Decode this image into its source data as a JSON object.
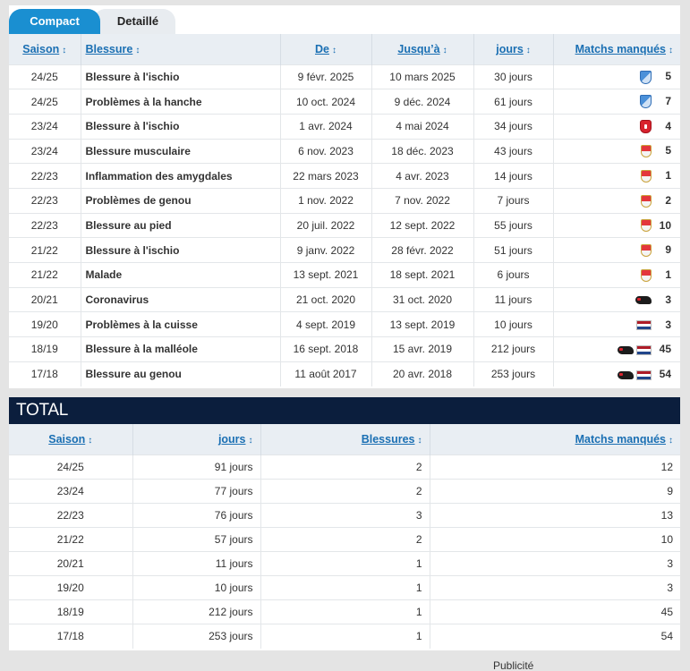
{
  "tabs": {
    "compact": "Compact",
    "detail": "Detaillé"
  },
  "injuries": {
    "headers": [
      "Saison",
      "Blessure",
      "De",
      "Jusqu’à",
      "jours",
      "Matchs manqués"
    ],
    "sort_glyph": "↕",
    "rows": [
      {
        "season": "24/25",
        "injury": "Blessure à l'ischio",
        "from": "9 févr. 2025",
        "until": "10 mars 2025",
        "days": "30 jours",
        "clubs": [
          "stuttgart-shield"
        ],
        "missed": "5"
      },
      {
        "season": "24/25",
        "injury": "Problèmes à la hanche",
        "from": "10 oct. 2024",
        "until": "9 déc. 2024",
        "days": "61 jours",
        "clubs": [
          "stuttgart-shield"
        ],
        "missed": "7"
      },
      {
        "season": "23/24",
        "injury": "Blessure à l'ischio",
        "from": "1 avr. 2024",
        "until": "4 mai 2024",
        "days": "34 jours",
        "clubs": [
          "twente-crest"
        ],
        "missed": "4"
      },
      {
        "season": "23/24",
        "injury": "Blessure musculaire",
        "from": "6 nov. 2023",
        "until": "18 déc. 2023",
        "days": "43 jours",
        "clubs": [
          "monaco-crest"
        ],
        "missed": "5"
      },
      {
        "season": "22/23",
        "injury": "Inflammation des amygdales",
        "from": "22 mars 2023",
        "until": "4 avr. 2023",
        "days": "14 jours",
        "clubs": [
          "monaco-crest"
        ],
        "missed": "1"
      },
      {
        "season": "22/23",
        "injury": "Problèmes de genou",
        "from": "1 nov. 2022",
        "until": "7 nov. 2022",
        "days": "7 jours",
        "clubs": [
          "monaco-crest"
        ],
        "missed": "2"
      },
      {
        "season": "22/23",
        "injury": "Blessure au pied",
        "from": "20 juil. 2022",
        "until": "12 sept. 2022",
        "days": "55 jours",
        "clubs": [
          "monaco-crest"
        ],
        "missed": "10"
      },
      {
        "season": "21/22",
        "injury": "Blessure à l'ischio",
        "from": "9 janv. 2022",
        "until": "28 févr. 2022",
        "days": "51 jours",
        "clubs": [
          "monaco-crest"
        ],
        "missed": "9"
      },
      {
        "season": "21/22",
        "injury": "Malade",
        "from": "13 sept. 2021",
        "until": "18 sept. 2021",
        "days": "6 jours",
        "clubs": [
          "monaco-crest"
        ],
        "missed": "1"
      },
      {
        "season": "20/21",
        "injury": "Coronavirus",
        "from": "21 oct. 2020",
        "until": "31 oct. 2020",
        "days": "11 jours",
        "clubs": [
          "az-lion-logo"
        ],
        "missed": "3"
      },
      {
        "season": "19/20",
        "injury": "Problèmes à la cuisse",
        "from": "4 sept. 2019",
        "until": "13 sept. 2019",
        "days": "10 jours",
        "clubs": [
          "netherlands-flag"
        ],
        "missed": "3"
      },
      {
        "season": "18/19",
        "injury": "Blessure à la malléole",
        "from": "16 sept. 2018",
        "until": "15 avr. 2019",
        "days": "212 jours",
        "clubs": [
          "az-lion-logo",
          "netherlands-flag"
        ],
        "missed": "45"
      },
      {
        "season": "17/18",
        "injury": "Blessure au genou",
        "from": "11 août 2017",
        "until": "20 avr. 2018",
        "days": "253 jours",
        "clubs": [
          "az-lion-logo",
          "netherlands-flag"
        ],
        "missed": "54"
      }
    ]
  },
  "total": {
    "title": "TOTAL",
    "headers": [
      "Saison",
      "jours",
      "Blessures",
      "Matchs manqués"
    ],
    "rows": [
      {
        "season": "24/25",
        "days": "91 jours",
        "injuries": "2",
        "missed": "12"
      },
      {
        "season": "23/24",
        "days": "77 jours",
        "injuries": "2",
        "missed": "9"
      },
      {
        "season": "22/23",
        "days": "76 jours",
        "injuries": "3",
        "missed": "13"
      },
      {
        "season": "21/22",
        "days": "57 jours",
        "injuries": "2",
        "missed": "10"
      },
      {
        "season": "20/21",
        "days": "11 jours",
        "injuries": "1",
        "missed": "3"
      },
      {
        "season": "19/20",
        "days": "10 jours",
        "injuries": "1",
        "missed": "3"
      },
      {
        "season": "18/19",
        "days": "212 jours",
        "injuries": "1",
        "missed": "45"
      },
      {
        "season": "17/18",
        "days": "253 jours",
        "injuries": "1",
        "missed": "54"
      }
    ]
  },
  "footer": {
    "ad_label": "Publicité"
  }
}
